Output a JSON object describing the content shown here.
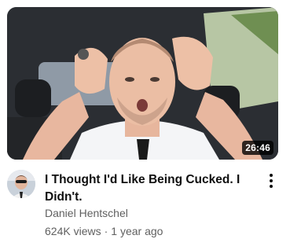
{
  "video": {
    "duration": "26:46",
    "title": "I Thought I'd Like Being Cucked. I Didn't.",
    "channel": "Daniel Hentschel",
    "views": "624K views",
    "age": "1 year ago",
    "separator": "·"
  },
  "icons": {
    "menu": "more-vert-icon"
  },
  "colors": {
    "title": "#0f0f0f",
    "secondary_text": "#606060",
    "duration_bg": "#000000"
  }
}
